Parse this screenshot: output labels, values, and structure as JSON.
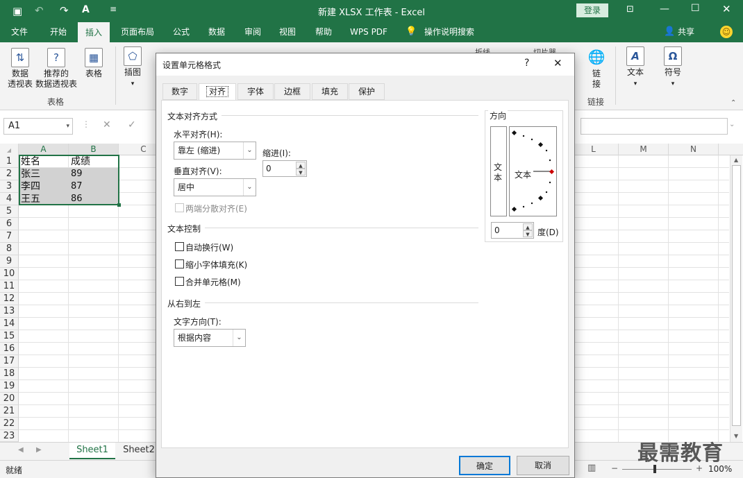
{
  "window": {
    "title": "新建 XLSX 工作表 - Excel",
    "login": "登录"
  },
  "tabs": [
    "文件",
    "开始",
    "插入",
    "页面布局",
    "公式",
    "数据",
    "审阅",
    "视图",
    "帮助",
    "WPS PDF",
    "操作说明搜索"
  ],
  "share": "共享",
  "ribbon": {
    "pivot1": "数据",
    "pivot2": "透视表",
    "rec1": "推荐的",
    "rec2": "数据透视表",
    "table": "表格",
    "group_table": "表格",
    "illus": "插图",
    "link1": "链",
    "link2": "接",
    "group_link": "链接",
    "text": "文本",
    "symbol": "符号",
    "partial1": "折线",
    "partial2": "切片器"
  },
  "namebox": "A1",
  "columns": [
    "A",
    "B",
    "C",
    "L",
    "M",
    "N"
  ],
  "rows": [
    "1",
    "2",
    "3",
    "4",
    "5",
    "6",
    "7",
    "8",
    "9",
    "10",
    "11",
    "12",
    "13",
    "14",
    "15",
    "16",
    "17",
    "18",
    "19",
    "20",
    "21",
    "22",
    "23"
  ],
  "cells": [
    [
      "姓名",
      "成绩"
    ],
    [
      "张三",
      "89"
    ],
    [
      "李四",
      "87"
    ],
    [
      "王五",
      "86"
    ]
  ],
  "sheets": [
    "Sheet1",
    "Sheet2"
  ],
  "status": {
    "ready": "就绪",
    "zoom": "100%"
  },
  "watermark": "最需教育",
  "dialog": {
    "title": "设置单元格格式",
    "help": "?",
    "close": "✕",
    "tabs": [
      "数字",
      "对齐",
      "字体",
      "边框",
      "填充",
      "保护"
    ],
    "align_section": "文本对齐方式",
    "h_align_label": "水平对齐(H):",
    "h_align_value": "靠左 (缩进)",
    "indent_label": "缩进(I):",
    "indent_value": "0",
    "v_align_label": "垂直对齐(V):",
    "v_align_value": "居中",
    "justify_distributed": "两端分散对齐(E)",
    "control_section": "文本控制",
    "wrap": "自动换行(W)",
    "shrink": "缩小字体填充(K)",
    "merge": "合并单元格(M)",
    "rtl_section": "从右到左",
    "direction_label": "文字方向(T):",
    "direction_value": "根据内容",
    "orientation_title": "方向",
    "orientation_vertical": "文本",
    "orientation_text": "文本",
    "degrees_value": "0",
    "degrees_label": "度(D)",
    "ok": "确定",
    "cancel": "取消"
  }
}
